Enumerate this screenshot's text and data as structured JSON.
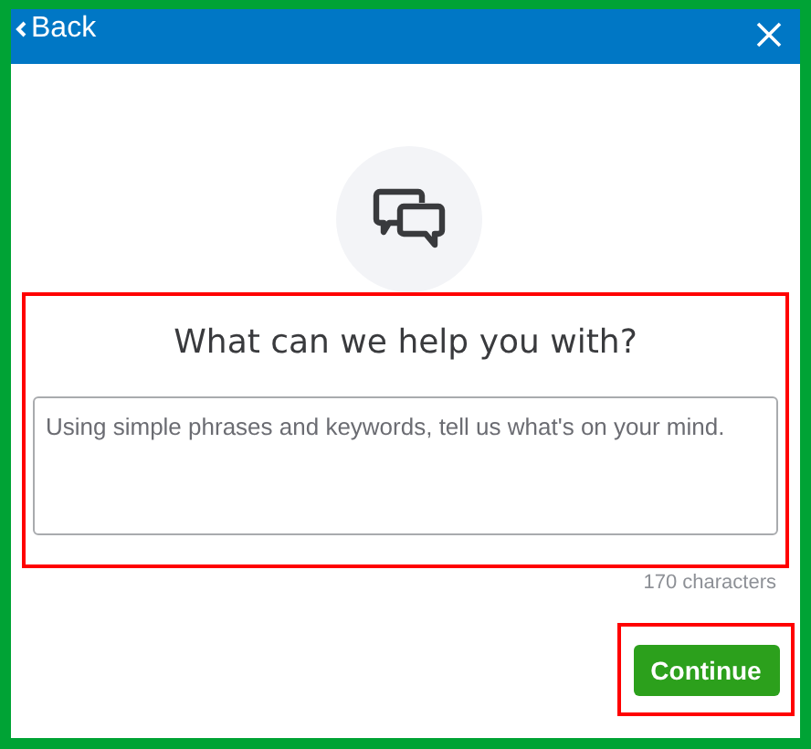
{
  "header": {
    "back_label": "Back"
  },
  "heading": "What can we help you with?",
  "message_field": {
    "placeholder": "Using simple phrases and keywords, tell us what's on your mind."
  },
  "character_count": "170 characters",
  "continue_button": "Continue"
}
